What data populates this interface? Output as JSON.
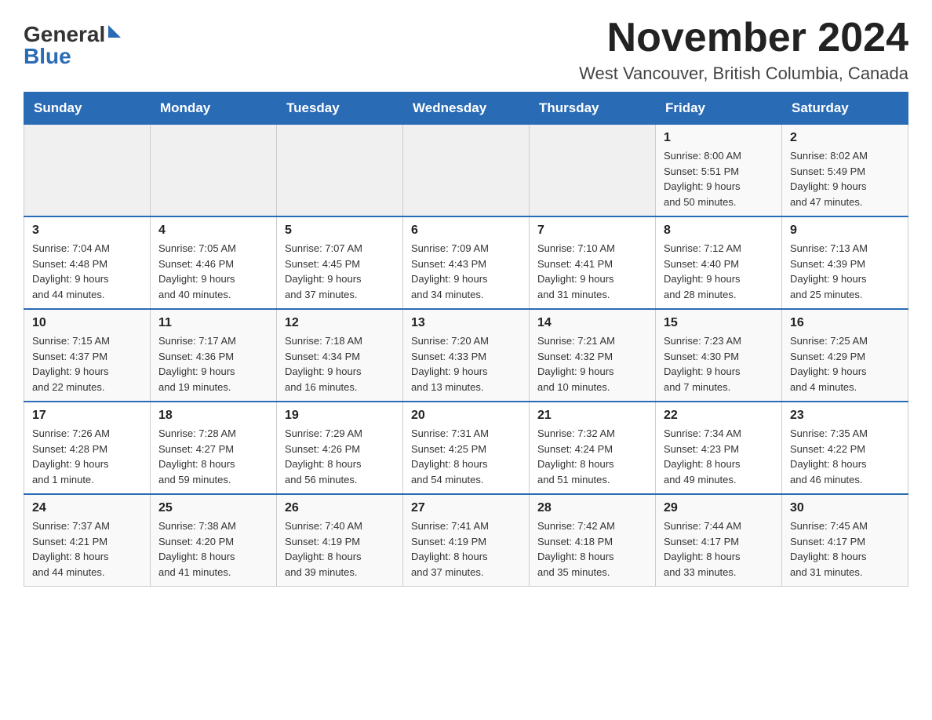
{
  "logo": {
    "general": "General",
    "blue": "Blue"
  },
  "header": {
    "month": "November 2024",
    "location": "West Vancouver, British Columbia, Canada"
  },
  "weekdays": [
    "Sunday",
    "Monday",
    "Tuesday",
    "Wednesday",
    "Thursday",
    "Friday",
    "Saturday"
  ],
  "weeks": [
    [
      {
        "day": "",
        "detail": ""
      },
      {
        "day": "",
        "detail": ""
      },
      {
        "day": "",
        "detail": ""
      },
      {
        "day": "",
        "detail": ""
      },
      {
        "day": "",
        "detail": ""
      },
      {
        "day": "1",
        "detail": "Sunrise: 8:00 AM\nSunset: 5:51 PM\nDaylight: 9 hours\nand 50 minutes."
      },
      {
        "day": "2",
        "detail": "Sunrise: 8:02 AM\nSunset: 5:49 PM\nDaylight: 9 hours\nand 47 minutes."
      }
    ],
    [
      {
        "day": "3",
        "detail": "Sunrise: 7:04 AM\nSunset: 4:48 PM\nDaylight: 9 hours\nand 44 minutes."
      },
      {
        "day": "4",
        "detail": "Sunrise: 7:05 AM\nSunset: 4:46 PM\nDaylight: 9 hours\nand 40 minutes."
      },
      {
        "day": "5",
        "detail": "Sunrise: 7:07 AM\nSunset: 4:45 PM\nDaylight: 9 hours\nand 37 minutes."
      },
      {
        "day": "6",
        "detail": "Sunrise: 7:09 AM\nSunset: 4:43 PM\nDaylight: 9 hours\nand 34 minutes."
      },
      {
        "day": "7",
        "detail": "Sunrise: 7:10 AM\nSunset: 4:41 PM\nDaylight: 9 hours\nand 31 minutes."
      },
      {
        "day": "8",
        "detail": "Sunrise: 7:12 AM\nSunset: 4:40 PM\nDaylight: 9 hours\nand 28 minutes."
      },
      {
        "day": "9",
        "detail": "Sunrise: 7:13 AM\nSunset: 4:39 PM\nDaylight: 9 hours\nand 25 minutes."
      }
    ],
    [
      {
        "day": "10",
        "detail": "Sunrise: 7:15 AM\nSunset: 4:37 PM\nDaylight: 9 hours\nand 22 minutes."
      },
      {
        "day": "11",
        "detail": "Sunrise: 7:17 AM\nSunset: 4:36 PM\nDaylight: 9 hours\nand 19 minutes."
      },
      {
        "day": "12",
        "detail": "Sunrise: 7:18 AM\nSunset: 4:34 PM\nDaylight: 9 hours\nand 16 minutes."
      },
      {
        "day": "13",
        "detail": "Sunrise: 7:20 AM\nSunset: 4:33 PM\nDaylight: 9 hours\nand 13 minutes."
      },
      {
        "day": "14",
        "detail": "Sunrise: 7:21 AM\nSunset: 4:32 PM\nDaylight: 9 hours\nand 10 minutes."
      },
      {
        "day": "15",
        "detail": "Sunrise: 7:23 AM\nSunset: 4:30 PM\nDaylight: 9 hours\nand 7 minutes."
      },
      {
        "day": "16",
        "detail": "Sunrise: 7:25 AM\nSunset: 4:29 PM\nDaylight: 9 hours\nand 4 minutes."
      }
    ],
    [
      {
        "day": "17",
        "detail": "Sunrise: 7:26 AM\nSunset: 4:28 PM\nDaylight: 9 hours\nand 1 minute."
      },
      {
        "day": "18",
        "detail": "Sunrise: 7:28 AM\nSunset: 4:27 PM\nDaylight: 8 hours\nand 59 minutes."
      },
      {
        "day": "19",
        "detail": "Sunrise: 7:29 AM\nSunset: 4:26 PM\nDaylight: 8 hours\nand 56 minutes."
      },
      {
        "day": "20",
        "detail": "Sunrise: 7:31 AM\nSunset: 4:25 PM\nDaylight: 8 hours\nand 54 minutes."
      },
      {
        "day": "21",
        "detail": "Sunrise: 7:32 AM\nSunset: 4:24 PM\nDaylight: 8 hours\nand 51 minutes."
      },
      {
        "day": "22",
        "detail": "Sunrise: 7:34 AM\nSunset: 4:23 PM\nDaylight: 8 hours\nand 49 minutes."
      },
      {
        "day": "23",
        "detail": "Sunrise: 7:35 AM\nSunset: 4:22 PM\nDaylight: 8 hours\nand 46 minutes."
      }
    ],
    [
      {
        "day": "24",
        "detail": "Sunrise: 7:37 AM\nSunset: 4:21 PM\nDaylight: 8 hours\nand 44 minutes."
      },
      {
        "day": "25",
        "detail": "Sunrise: 7:38 AM\nSunset: 4:20 PM\nDaylight: 8 hours\nand 41 minutes."
      },
      {
        "day": "26",
        "detail": "Sunrise: 7:40 AM\nSunset: 4:19 PM\nDaylight: 8 hours\nand 39 minutes."
      },
      {
        "day": "27",
        "detail": "Sunrise: 7:41 AM\nSunset: 4:19 PM\nDaylight: 8 hours\nand 37 minutes."
      },
      {
        "day": "28",
        "detail": "Sunrise: 7:42 AM\nSunset: 4:18 PM\nDaylight: 8 hours\nand 35 minutes."
      },
      {
        "day": "29",
        "detail": "Sunrise: 7:44 AM\nSunset: 4:17 PM\nDaylight: 8 hours\nand 33 minutes."
      },
      {
        "day": "30",
        "detail": "Sunrise: 7:45 AM\nSunset: 4:17 PM\nDaylight: 8 hours\nand 31 minutes."
      }
    ]
  ]
}
